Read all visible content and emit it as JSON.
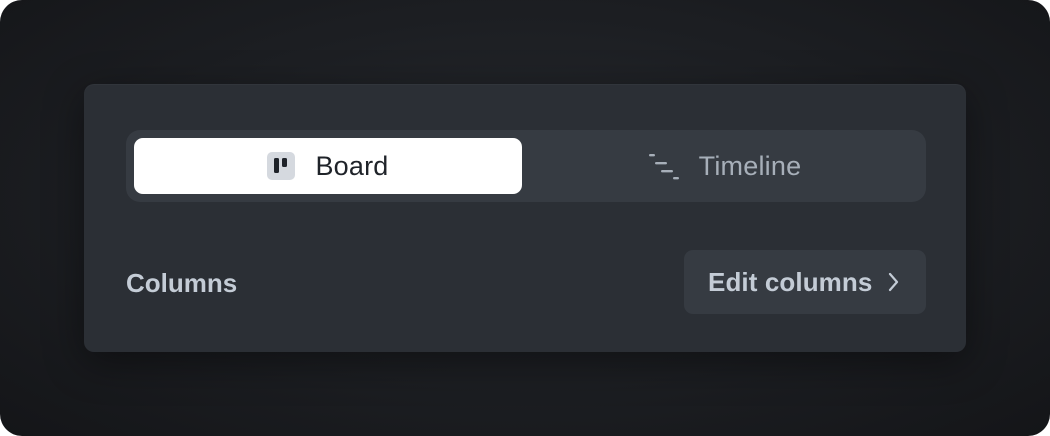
{
  "view_switcher": {
    "board": {
      "label": "Board",
      "icon": "board-icon",
      "selected": true
    },
    "timeline": {
      "label": "Timeline",
      "icon": "timeline-icon",
      "selected": false
    }
  },
  "columns": {
    "label": "Columns",
    "edit_button_label": "Edit columns",
    "edit_button_icon": "chevron-right-icon"
  },
  "colors": {
    "frame_bg": "#1c1e22",
    "panel_bg": "#2b2f35",
    "segment_track": "#363b42",
    "selected_segment": "#ffffff",
    "muted_text": "#a7afb9",
    "label_text": "#c4ccd6"
  }
}
